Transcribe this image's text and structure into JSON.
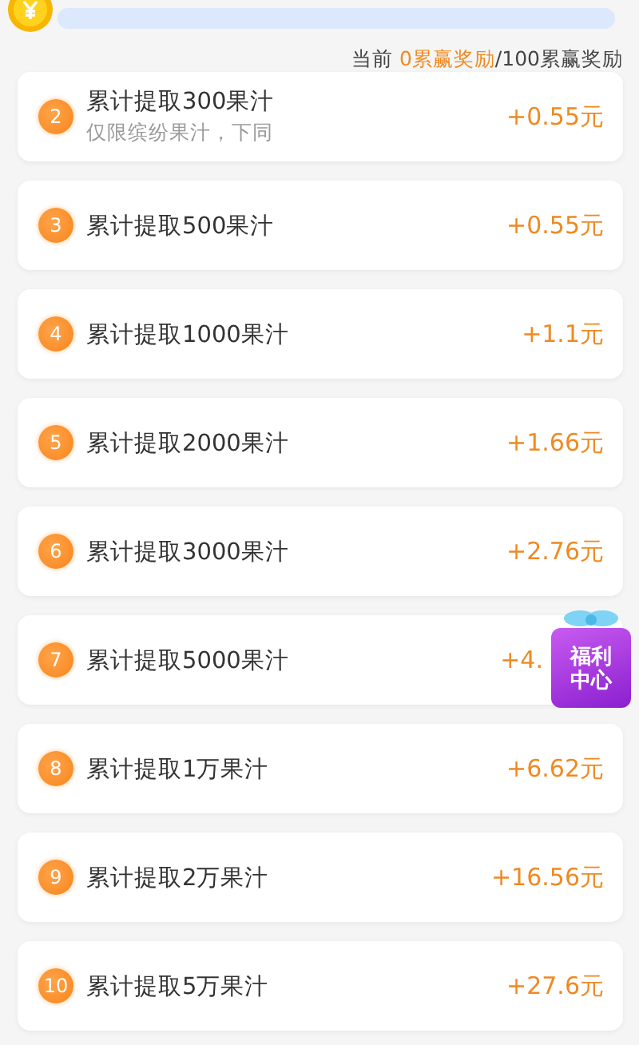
{
  "progress": {
    "level": 0,
    "prefix": "当前 ",
    "current": "0累赢奖励",
    "total": "/100累赢奖励"
  },
  "tasks": [
    {
      "index": "2",
      "title": "累计提取300果汁",
      "note": "仅限缤纷果汁，下同",
      "reward": "+0.55元"
    },
    {
      "index": "3",
      "title": "累计提取500果汁",
      "reward": "+0.55元"
    },
    {
      "index": "4",
      "title": "累计提取1000果汁",
      "reward": "+1.1元"
    },
    {
      "index": "5",
      "title": "累计提取2000果汁",
      "reward": "+1.66元"
    },
    {
      "index": "6",
      "title": "累计提取3000果汁",
      "reward": "+2.76元"
    },
    {
      "index": "7",
      "title": "累计提取5000果汁",
      "reward": "+4.",
      "covered_by_badge": true
    },
    {
      "index": "8",
      "title": "累计提取1万果汁",
      "reward": "+6.62元"
    },
    {
      "index": "9",
      "title": "累计提取2万果汁",
      "reward": "+16.56元"
    },
    {
      "index": "10",
      "title": "累计提取5万果汁",
      "reward": "+27.6元"
    }
  ],
  "floating_badge": {
    "line_1": "福利",
    "line_2": "中心"
  }
}
